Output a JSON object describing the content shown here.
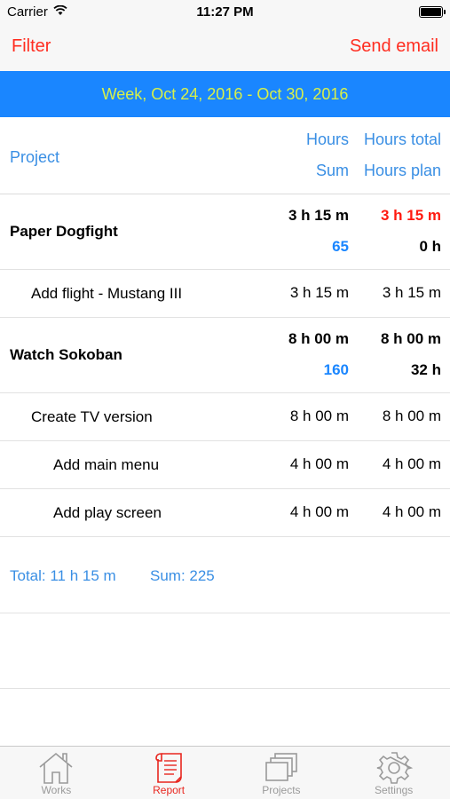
{
  "status": {
    "carrier": "Carrier",
    "time": "11:27 PM"
  },
  "nav": {
    "left": "Filter",
    "right": "Send email"
  },
  "week": "Week, Oct 24, 2016 - Oct 30, 2016",
  "header": {
    "project": "Project",
    "hours": "Hours",
    "hours_total": "Hours total",
    "sum": "Sum",
    "hours_plan": "Hours plan"
  },
  "rows": [
    {
      "name": "Paper Dogfight",
      "hours": "3 h 15 m",
      "hours_total": "3 h 15 m",
      "sum": "65",
      "hours_plan": "0 h"
    },
    {
      "name": "Add flight - Mustang III",
      "hours": "3 h 15 m",
      "hours_total": "3 h 15 m"
    },
    {
      "name": "Watch Sokoban",
      "hours": "8 h 00 m",
      "hours_total": "8 h 00 m",
      "sum": "160",
      "hours_plan": "32 h"
    },
    {
      "name": "Create TV version",
      "hours": "8 h 00 m",
      "hours_total": "8 h 00 m"
    },
    {
      "name": "Add main menu",
      "hours": "4 h 00 m",
      "hours_total": "4 h 00 m"
    },
    {
      "name": "Add play screen",
      "hours": "4 h 00 m",
      "hours_total": "4 h 00 m"
    }
  ],
  "totals": {
    "total": "Total: 11 h 15 m",
    "sum": "Sum: 225"
  },
  "tabs": [
    {
      "label": "Works",
      "icon": "house-icon"
    },
    {
      "label": "Report",
      "icon": "scroll-icon"
    },
    {
      "label": "Projects",
      "icon": "stacked-windows-icon"
    },
    {
      "label": "Settings",
      "icon": "gear-icon"
    }
  ],
  "colors": {
    "accent_red": "#ff2d20",
    "banner_blue": "#1a86ff",
    "banner_text": "#d7f04a",
    "header_blue": "#3a8fe4",
    "inactive_gray": "#9a9a9a"
  }
}
